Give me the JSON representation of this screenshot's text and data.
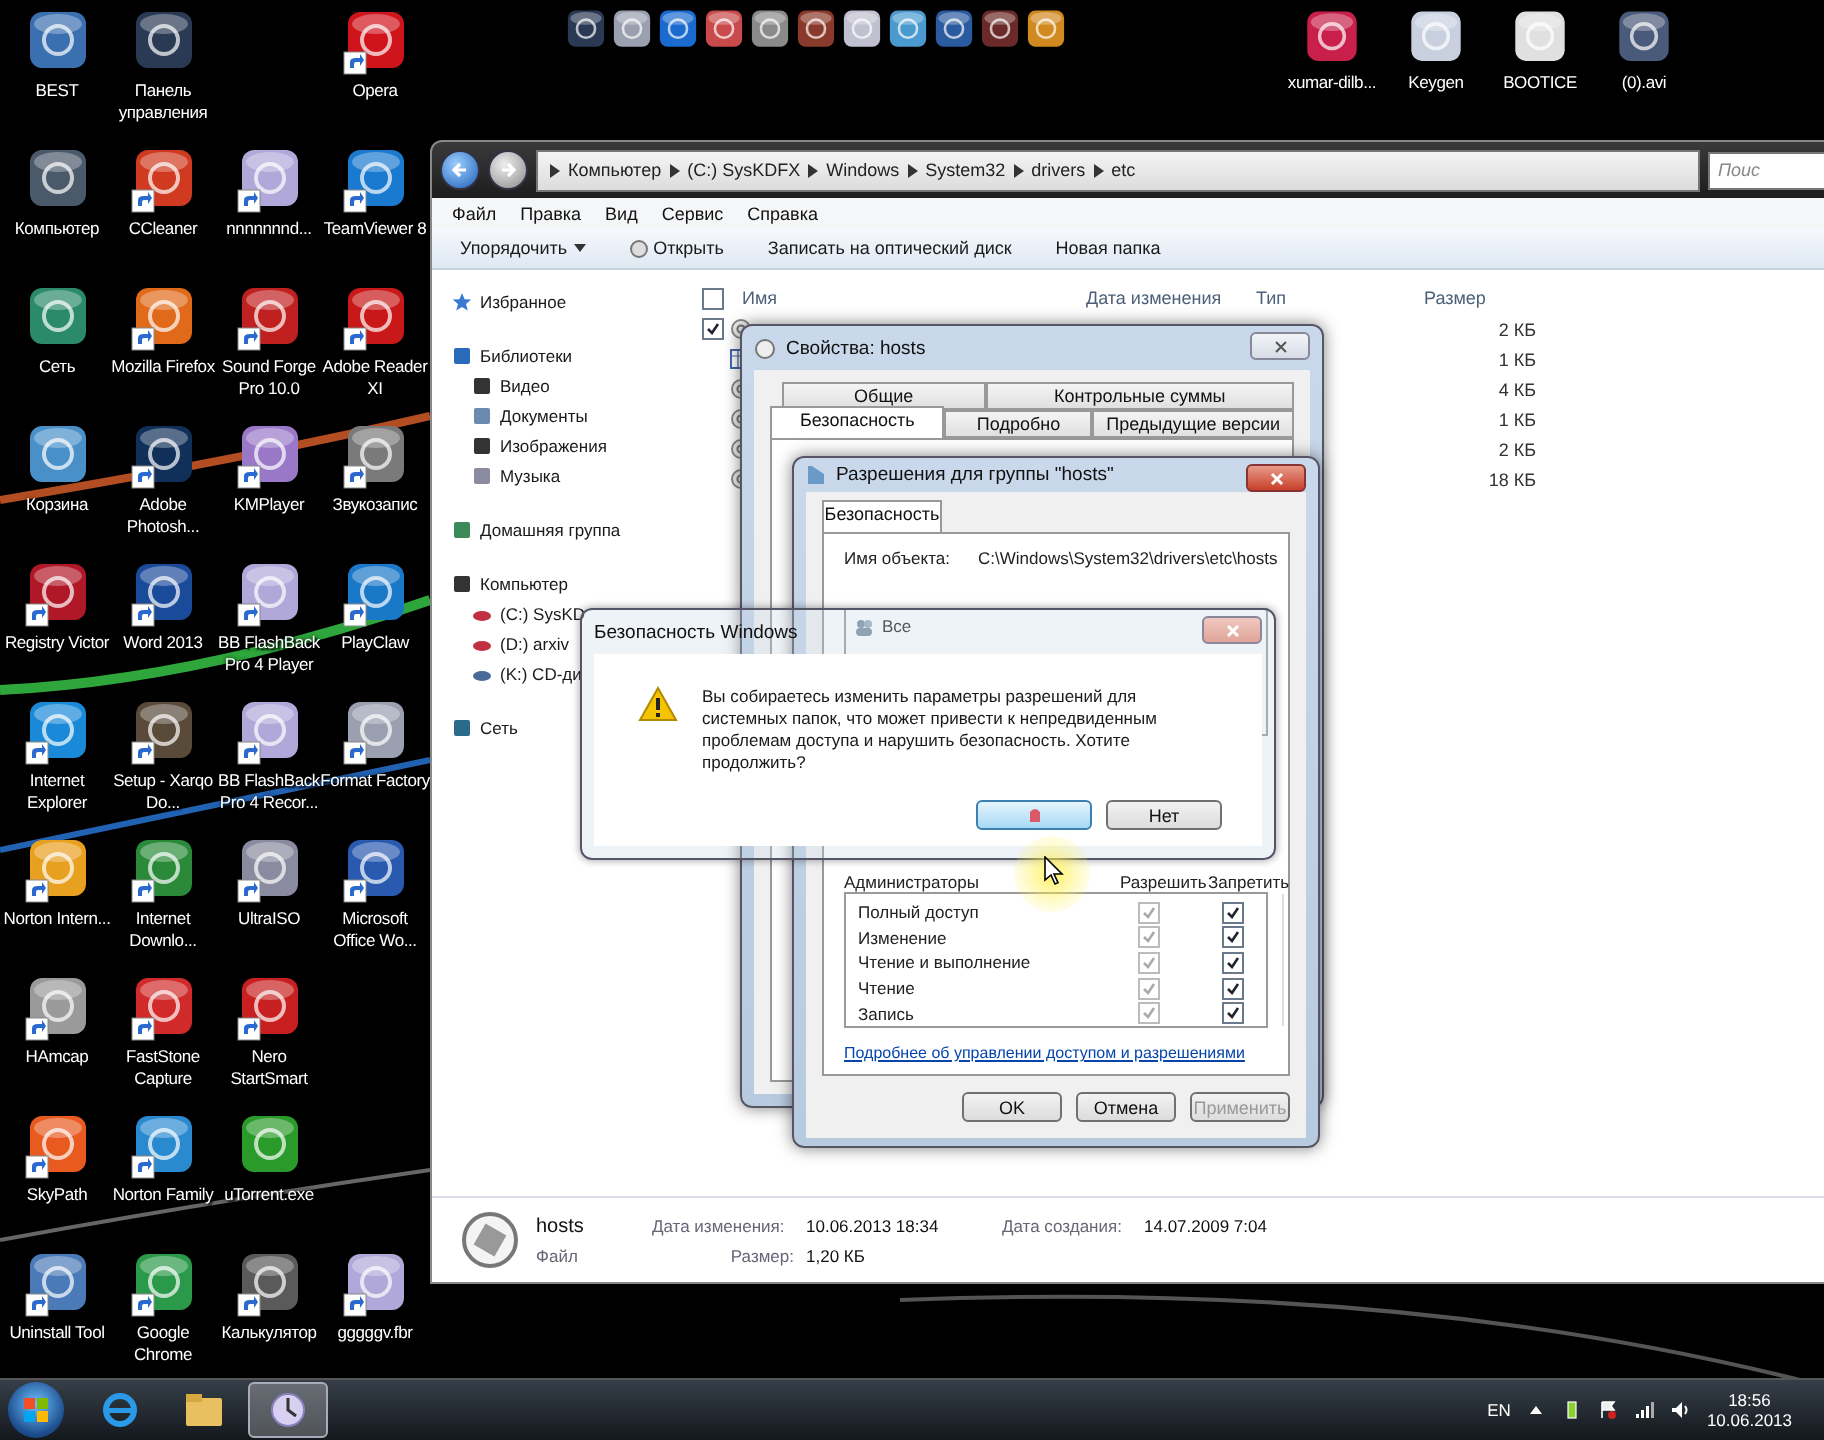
{
  "desktop_icons": [
    {
      "kind": "system",
      "label": "BEST",
      "color": "#3a6fb0"
    },
    {
      "kind": "system",
      "label": "Панель управления",
      "color": "#2a3a55"
    },
    {
      "kind": "empty"
    },
    {
      "kind": "shortcut",
      "label": "Opera",
      "color": "#d0141c"
    },
    {
      "kind": "system",
      "label": "Компьютер",
      "color": "#4a5a6a"
    },
    {
      "kind": "shortcut",
      "label": "CCleaner",
      "color": "#d03a20"
    },
    {
      "kind": "shortcut",
      "label": "nnnnnnnd...",
      "color": "#b0a8d8"
    },
    {
      "kind": "shortcut",
      "label": "TeamViewer 8",
      "color": "#1a7ad0"
    },
    {
      "kind": "system",
      "label": "Сеть",
      "color": "#2a8a6a"
    },
    {
      "kind": "shortcut",
      "label": "Mozilla Firefox",
      "color": "#e06a1a"
    },
    {
      "kind": "shortcut",
      "label": "Sound Forge Pro 10.0",
      "color": "#c02020"
    },
    {
      "kind": "shortcut",
      "label": "Adobe Reader XI",
      "color": "#c81818"
    },
    {
      "kind": "system",
      "label": "Корзина",
      "color": "#4a90c8"
    },
    {
      "kind": "shortcut",
      "label": "Adobe Photosh...",
      "color": "#10305a"
    },
    {
      "kind": "shortcut",
      "label": "KMPlayer",
      "color": "#9a78c8"
    },
    {
      "kind": "shortcut",
      "label": "Звукозапис",
      "color": "#7a7a7a"
    },
    {
      "kind": "shortcut",
      "label": "Registry Victor",
      "color": "#b01828"
    },
    {
      "kind": "shortcut",
      "label": "Word 2013",
      "color": "#1a4a9a"
    },
    {
      "kind": "shortcut",
      "label": "BB FlashBack Pro 4 Player",
      "color": "#b0a8d8"
    },
    {
      "kind": "shortcut",
      "label": "PlayClaw",
      "color": "#1a78c8"
    },
    {
      "kind": "shortcut",
      "label": "Internet Explorer",
      "color": "#1a8ad8"
    },
    {
      "kind": "shortcut",
      "label": "Setup - Xarqo Do...",
      "color": "#5a4a3a"
    },
    {
      "kind": "shortcut",
      "label": "BB FlashBack Pro 4 Recor...",
      "color": "#b0a8d8"
    },
    {
      "kind": "shortcut",
      "label": "Format Factory",
      "color": "#9aa0b0"
    },
    {
      "kind": "shortcut",
      "label": "Norton Intern...",
      "color": "#e8a020"
    },
    {
      "kind": "shortcut",
      "label": "Internet Downlo...",
      "color": "#2a8a3a"
    },
    {
      "kind": "shortcut",
      "label": "UltraISO",
      "color": "#8a8aa0"
    },
    {
      "kind": "shortcut",
      "label": "Microsoft Office Wo...",
      "color": "#2a5ab0"
    },
    {
      "kind": "shortcut",
      "label": "HAmcap",
      "color": "#9a9a9a"
    },
    {
      "kind": "shortcut",
      "label": "FastStone Capture",
      "color": "#d02a2a"
    },
    {
      "kind": "shortcut",
      "label": "Nero StartSmart",
      "color": "#c82020"
    },
    {
      "kind": "empty"
    },
    {
      "kind": "shortcut",
      "label": "SkyPath",
      "color": "#e85a20"
    },
    {
      "kind": "shortcut",
      "label": "Norton Family",
      "color": "#2a8ad0"
    },
    {
      "kind": "system",
      "label": "uTorrent.exe",
      "color": "#2a9a2a"
    },
    {
      "kind": "empty"
    },
    {
      "kind": "shortcut",
      "label": "Uninstall Tool",
      "color": "#4a7ab8"
    },
    {
      "kind": "shortcut",
      "label": "Google Chrome",
      "color": "#2a9a4a"
    },
    {
      "kind": "shortcut",
      "label": "Калькулятор",
      "color": "#5a5a5a"
    },
    {
      "kind": "shortcut",
      "label": "gggggv.fbr",
      "color": "#b0a8d8"
    }
  ],
  "top_icons": [
    {
      "color": "#2a3a55"
    },
    {
      "color": "#9aa0b0"
    },
    {
      "color": "#1a6ad0"
    },
    {
      "color": "#c84a4a"
    },
    {
      "color": "#8a8a8a"
    },
    {
      "color": "#8a3a2a"
    },
    {
      "color": "#c0c0d0"
    },
    {
      "color": "#4a9ad0"
    },
    {
      "color": "#2a5aa0"
    },
    {
      "color": "#6a2a2a"
    },
    {
      "color": "#d08a20"
    }
  ],
  "top_labeled_icons": [
    {
      "label": "xumar-dilb...",
      "color": "#c8204a"
    },
    {
      "label": "Keygen",
      "color": "#c8d0e0"
    },
    {
      "label": "BOOTICE",
      "color": "#e0e0e0"
    },
    {
      "label": "(0).avi",
      "color": "#4a5a7a"
    }
  ],
  "explorer": {
    "breadcrumb": [
      "Компьютер",
      "(C:) SysKDFX",
      "Windows",
      "System32",
      "drivers",
      "etc"
    ],
    "search": {
      "placeholder": "Поис"
    },
    "menu": [
      "Файл",
      "Правка",
      "Вид",
      "Сервис",
      "Справка"
    ],
    "toolbar": [
      {
        "kind": "dropdown",
        "label": "Упорядочить"
      },
      {
        "kind": "icon",
        "label": "Открыть"
      },
      {
        "kind": "plain",
        "label": "Записать на оптический диск"
      },
      {
        "kind": "plain",
        "label": "Новая папка"
      }
    ],
    "nav": [
      {
        "kind": "star",
        "label": "Избранное"
      },
      {
        "kind": "library",
        "label": "Библиотеки",
        "children": [
          {
            "kind": "video",
            "label": "Видео"
          },
          {
            "kind": "docs",
            "label": "Документы"
          },
          {
            "kind": "pictures",
            "label": "Изображения"
          },
          {
            "kind": "music",
            "label": "Музыка"
          }
        ]
      },
      {
        "kind": "homegroup",
        "label": "Домашняя группа"
      },
      {
        "kind": "computer",
        "label": "Компьютер",
        "children": [
          {
            "kind": "drive",
            "label": "(C:) SysKD"
          },
          {
            "kind": "drive",
            "label": "(D:) arxiv"
          },
          {
            "kind": "cd",
            "label": "(K:) CD-ди"
          }
        ]
      },
      {
        "kind": "network",
        "label": "Сеть"
      }
    ],
    "select_all_checked": false,
    "columns": [
      "Имя",
      "Дата изменения",
      "Тип",
      "Размер"
    ],
    "rows": [
      {
        "kind": "gear",
        "checked": true,
        "size": "2 КБ"
      },
      {
        "kind": "table",
        "checked": false,
        "size": "1 КБ"
      },
      {
        "kind": "gear",
        "checked": false,
        "size": "4 КБ"
      },
      {
        "kind": "gear",
        "checked": false,
        "size": "1 КБ"
      },
      {
        "kind": "gear",
        "checked": false,
        "size": "2 КБ"
      },
      {
        "kind": "gear",
        "checked": false,
        "size": "18 КБ"
      }
    ],
    "details": {
      "name": "hosts",
      "type": "Файл",
      "modified_label": "Дата изменения:",
      "modified": "10.06.2013 18:34",
      "size_label": "Размер:",
      "size": "1,20 КБ",
      "created_label": "Дата создания:",
      "created": "14.07.2009 7:04"
    }
  },
  "properties_dialog": {
    "title": "Свойства: hosts",
    "tabs_back": [
      {
        "label": "Общие",
        "selected": false
      },
      {
        "label": "Контрольные суммы",
        "selected": false
      }
    ],
    "tabs_front": [
      {
        "label": "Безопасность",
        "selected": true
      },
      {
        "label": "Подробно",
        "selected": false
      },
      {
        "label": "Предыдущие версии",
        "selected": false
      }
    ]
  },
  "permissions_dialog": {
    "title": "Разрешения для группы \"hosts\"",
    "tab": "Безопасность",
    "object_label": "Имя объекта:",
    "object_path": "C:\\Windows\\System32\\drivers\\etc\\hosts",
    "groups": [
      {
        "label": "Все",
        "selected": false
      }
    ],
    "perm_header": "Администраторы",
    "allow_header": "Разрешить",
    "deny_header": "Запретить",
    "permissions": [
      {
        "name": "Полный доступ",
        "allow": true,
        "allow_disabled": true,
        "deny": true
      },
      {
        "name": "Изменение",
        "allow": true,
        "allow_disabled": true,
        "deny": true
      },
      {
        "name": "Чтение и выполнение",
        "allow": true,
        "allow_disabled": true,
        "deny": true
      },
      {
        "name": "Чтение",
        "allow": true,
        "allow_disabled": true,
        "deny": true
      },
      {
        "name": "Запись",
        "allow": true,
        "allow_disabled": true,
        "deny": true
      }
    ],
    "link": "Подробнее об управлении доступом и разрешениями",
    "buttons": [
      {
        "label": "OK",
        "disabled": false
      },
      {
        "label": "Отмена",
        "disabled": false
      },
      {
        "label": "Применить",
        "disabled": true
      }
    ]
  },
  "security_dialog": {
    "title": "Безопасность Windows",
    "message": "Вы собираетесь изменить параметры разрешений для системных папок, что может привести к непредвиденным проблемам доступа и нарушить безопасность. Хотите продолжить?",
    "buttons": [
      {
        "focused": true
      },
      {
        "label": "Нет",
        "focused": false
      }
    ]
  },
  "taskbar": {
    "items": [
      {
        "kind": "ie",
        "active": false
      },
      {
        "kind": "folder",
        "active": false
      },
      {
        "kind": "app",
        "active": true
      }
    ],
    "language": "EN",
    "time": "18:56",
    "date": "10.06.2013"
  }
}
